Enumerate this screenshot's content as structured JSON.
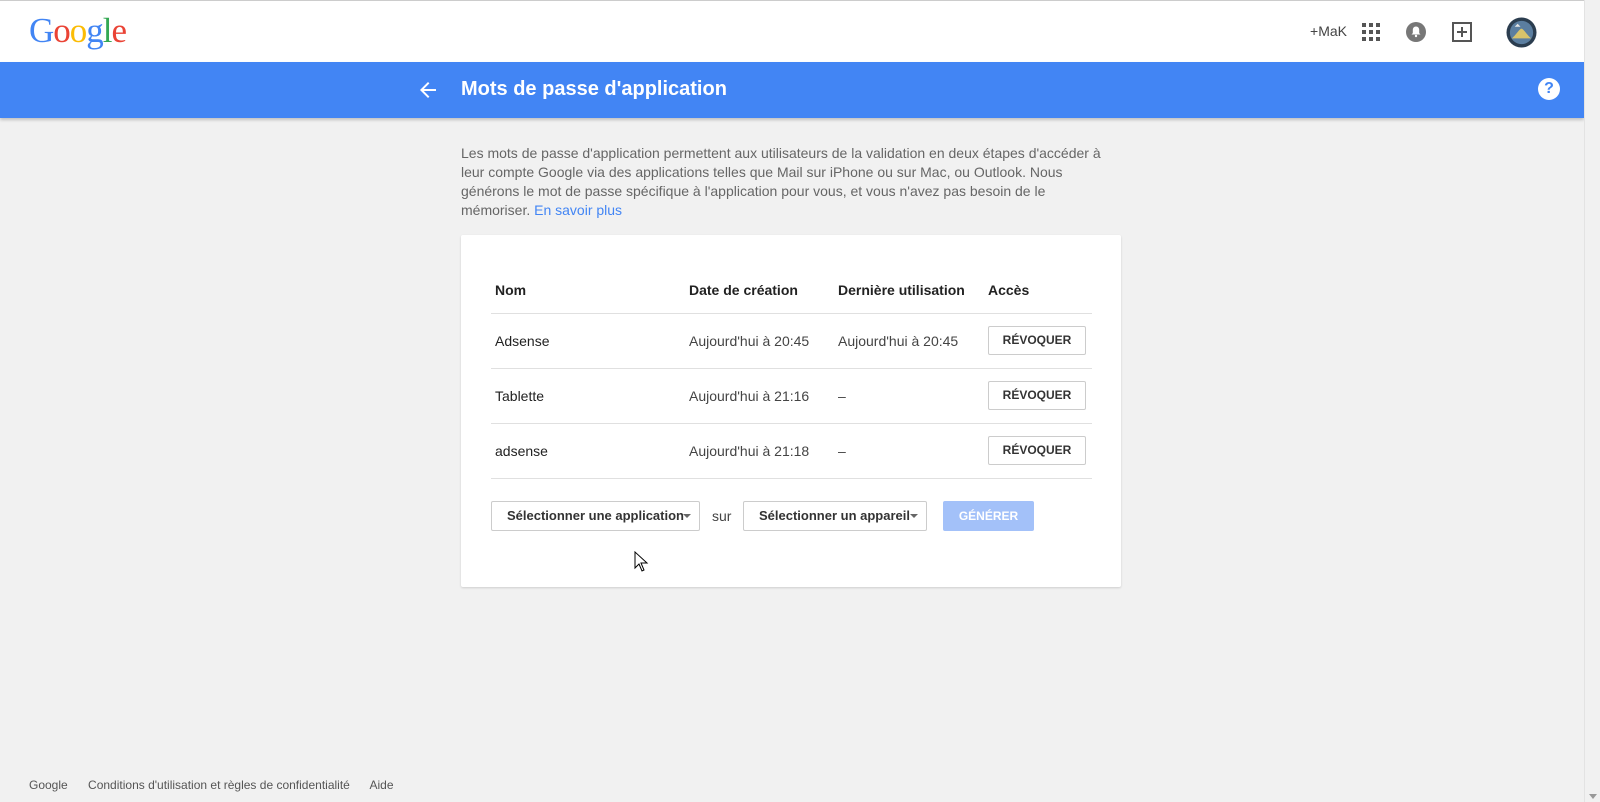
{
  "header": {
    "logo_letters": [
      "G",
      "o",
      "o",
      "g",
      "l",
      "e"
    ],
    "logo_colors": [
      "#4285f4",
      "#ea4335",
      "#fbbc05",
      "#4285f4",
      "#34a853",
      "#ea4335"
    ],
    "plus_name": "+MaK",
    "icons": [
      "apps-grid-icon",
      "notifications-bell-icon",
      "share-plus-icon",
      "avatar"
    ]
  },
  "bluebar": {
    "title": "Mots de passe d'application",
    "color": "#4285f4",
    "help": "?"
  },
  "intro": {
    "text": "Les mots de passe d'application permettent aux utilisateurs de la validation en deux étapes d'accéder à leur compte Google via des applications telles que Mail sur iPhone ou sur Mac, ou Outlook. Nous générons le mot de passe spécifique à l'application pour vous, et vous n'avez pas besoin de le mémoriser.",
    "link": "En savoir plus"
  },
  "table": {
    "headers": [
      "Nom",
      "Date de création",
      "Dernière utilisation",
      "Accès"
    ],
    "rows": [
      {
        "name": "Adsense",
        "created": "Aujourd'hui à 20:45",
        "last_used": "Aujourd'hui à 20:45",
        "action": "RÉVOQUER"
      },
      {
        "name": "Tablette",
        "created": "Aujourd'hui à 21:16",
        "last_used": "–",
        "action": "RÉVOQUER"
      },
      {
        "name": "adsense",
        "created": "Aujourd'hui à 21:18",
        "last_used": "–",
        "action": "RÉVOQUER"
      }
    ]
  },
  "controls": {
    "select_app": "Sélectionner une application",
    "sur": "sur",
    "select_device": "Sélectionner un appareil",
    "generate": "GÉNÉRER"
  },
  "footer": {
    "links": [
      "Google",
      "Conditions d'utilisation et règles de confidentialité",
      "Aide"
    ]
  }
}
